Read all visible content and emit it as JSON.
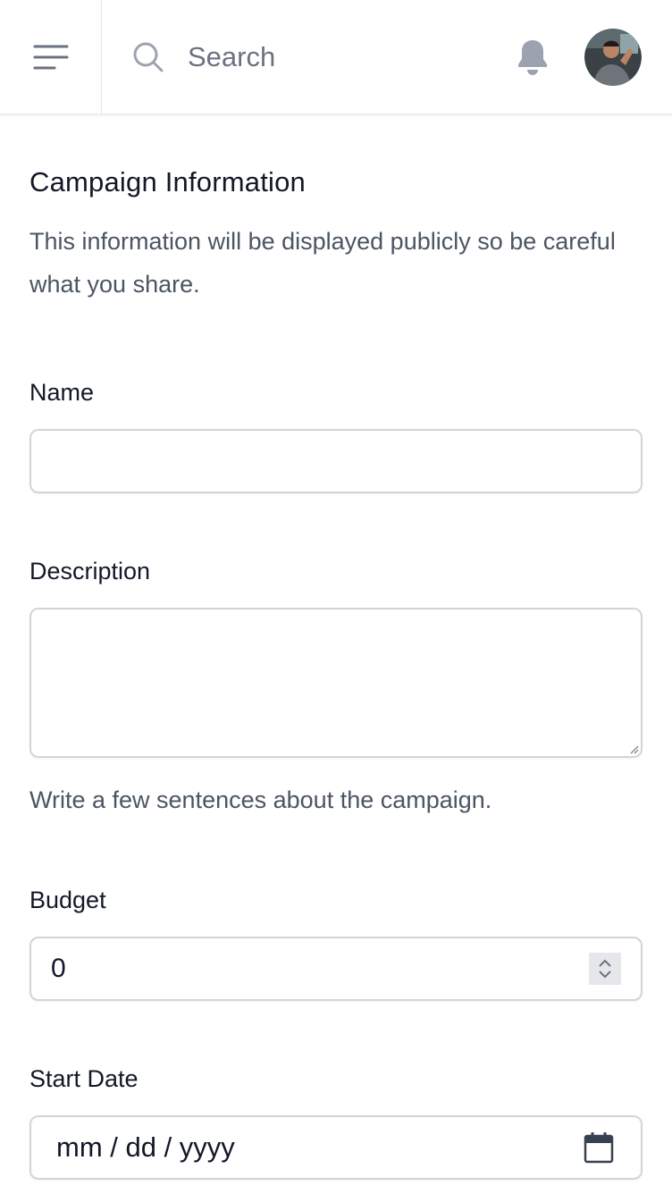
{
  "header": {
    "search_placeholder": "Search"
  },
  "icons": {
    "menu": "menu-icon",
    "search": "search-icon",
    "notifications": "bell-icon",
    "profile": "avatar",
    "calendar": "calendar-icon",
    "stepper": "chevron-up-down-icon"
  },
  "form": {
    "title": "Campaign Information",
    "description": "This information will be displayed publicly so be careful what you share.",
    "name": {
      "label": "Name",
      "value": ""
    },
    "desc_field": {
      "label": "Description",
      "value": "",
      "hint": "Write a few sentences about the campaign."
    },
    "budget": {
      "label": "Budget",
      "value": "0"
    },
    "start_date": {
      "label": "Start Date",
      "placeholder": "mm / dd / yyyy"
    }
  },
  "colors": {
    "border": "#d1d5db",
    "text": "#111827",
    "muted": "#4b5563",
    "icon": "#9ca3af"
  }
}
